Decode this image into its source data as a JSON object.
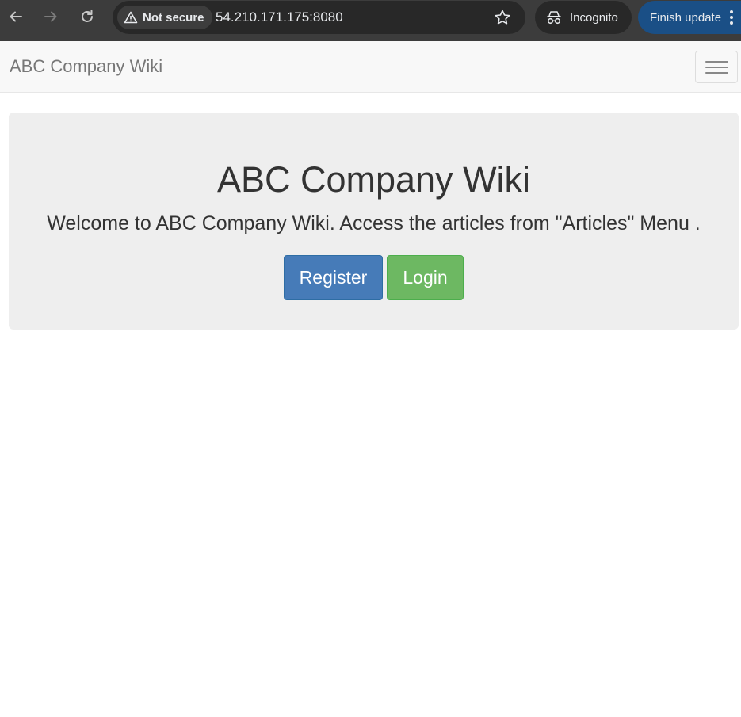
{
  "browser": {
    "security_label": "Not secure",
    "url": "54.210.171.175:8080",
    "incognito_label": "Incognito",
    "update_label": "Finish update",
    "icons": {
      "back": "arrow-left-icon",
      "forward": "arrow-right-icon",
      "reload": "reload-icon",
      "warning": "warning-triangle-icon",
      "bookmark": "star-icon",
      "incognito": "incognito-icon",
      "menu": "kebab-menu-icon"
    },
    "colors": {
      "chrome": "#3c3c3c",
      "omnibox": "#282828",
      "update_pill": "#1a4f86"
    }
  },
  "navbar": {
    "brand": "ABC Company Wiki",
    "toggle_icon": "hamburger-icon"
  },
  "hero": {
    "title": "ABC Company Wiki",
    "lead": "Welcome to ABC Company Wiki. Access the articles from \"Articles\" Menu .",
    "register_label": "Register",
    "login_label": "Login",
    "colors": {
      "register": "#467bb8",
      "login": "#6db862",
      "background": "#eeeeee"
    }
  }
}
